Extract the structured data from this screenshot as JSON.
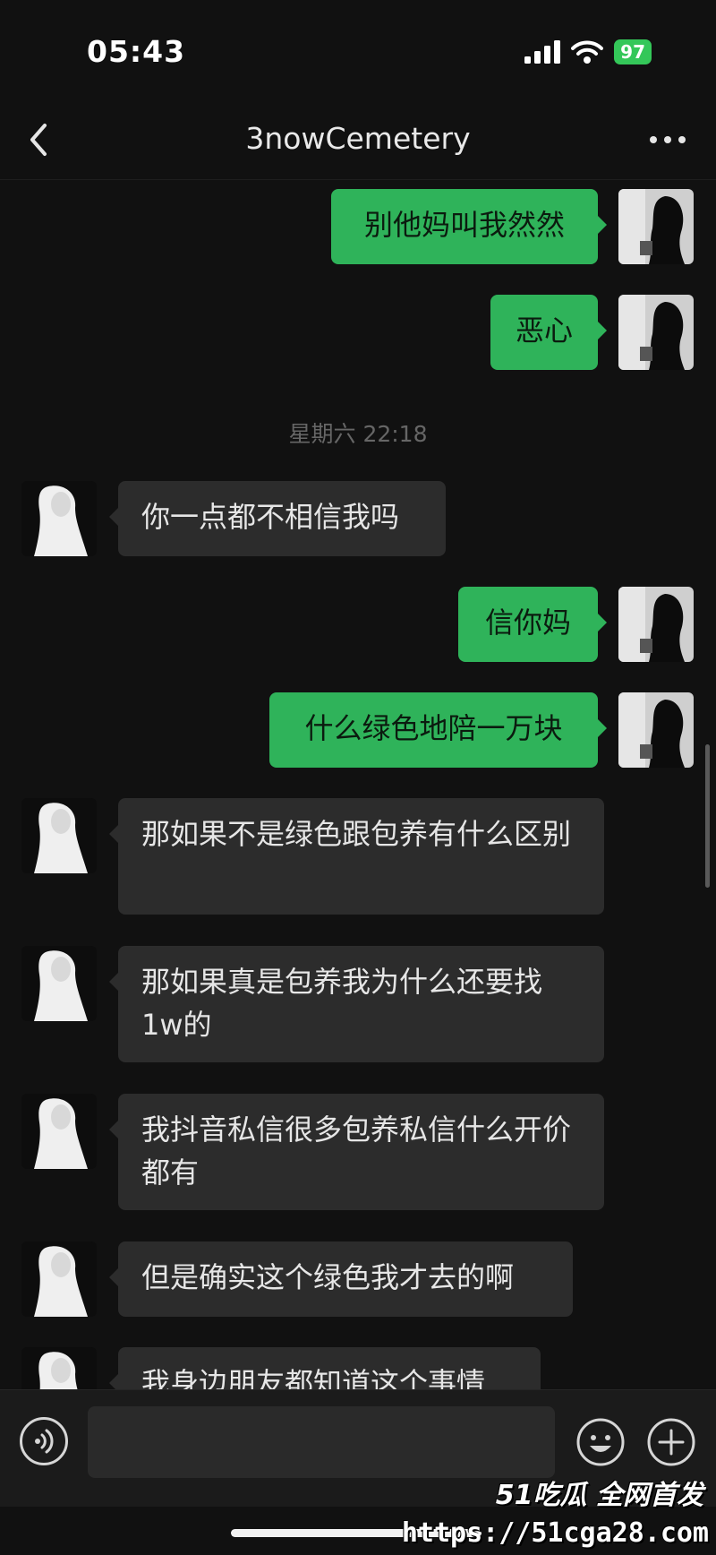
{
  "status_bar": {
    "time": "05:43",
    "battery": "97"
  },
  "nav": {
    "title": "3nowCemetery"
  },
  "messages": [
    {
      "side": "out",
      "text": "别他妈叫我然然"
    },
    {
      "side": "out",
      "text": "恶心"
    },
    {
      "type": "time",
      "text": "星期六 22:18"
    },
    {
      "side": "in",
      "text": "你一点都不相信我吗"
    },
    {
      "side": "out",
      "text": "信你妈"
    },
    {
      "side": "out",
      "text": "什么绿色地陪一万块"
    },
    {
      "side": "in",
      "text": "那如果不是绿色跟包养有什么区别"
    },
    {
      "side": "in",
      "text": "那如果真是包养我为什么还要找1w的"
    },
    {
      "side": "in",
      "text": "我抖音私信很多包养私信什么开价都有"
    },
    {
      "side": "in",
      "text": "但是确实这个绿色我才去的啊"
    },
    {
      "side": "in",
      "text": "我身边朋友都知道这个事情"
    }
  ],
  "input_bar": {
    "placeholder": ""
  },
  "watermark": {
    "brand": "51吃瓜 全网首发",
    "url": "https://51cga28.com"
  },
  "colors": {
    "outgoing_bubble": "#2fb35a",
    "incoming_bubble": "#2c2c2c",
    "background": "#111111"
  },
  "icons": [
    "back-arrow-icon",
    "more-dots-icon",
    "voice-icon",
    "emoji-icon",
    "plus-icon",
    "signal-icon",
    "wifi-icon",
    "battery-icon"
  ]
}
